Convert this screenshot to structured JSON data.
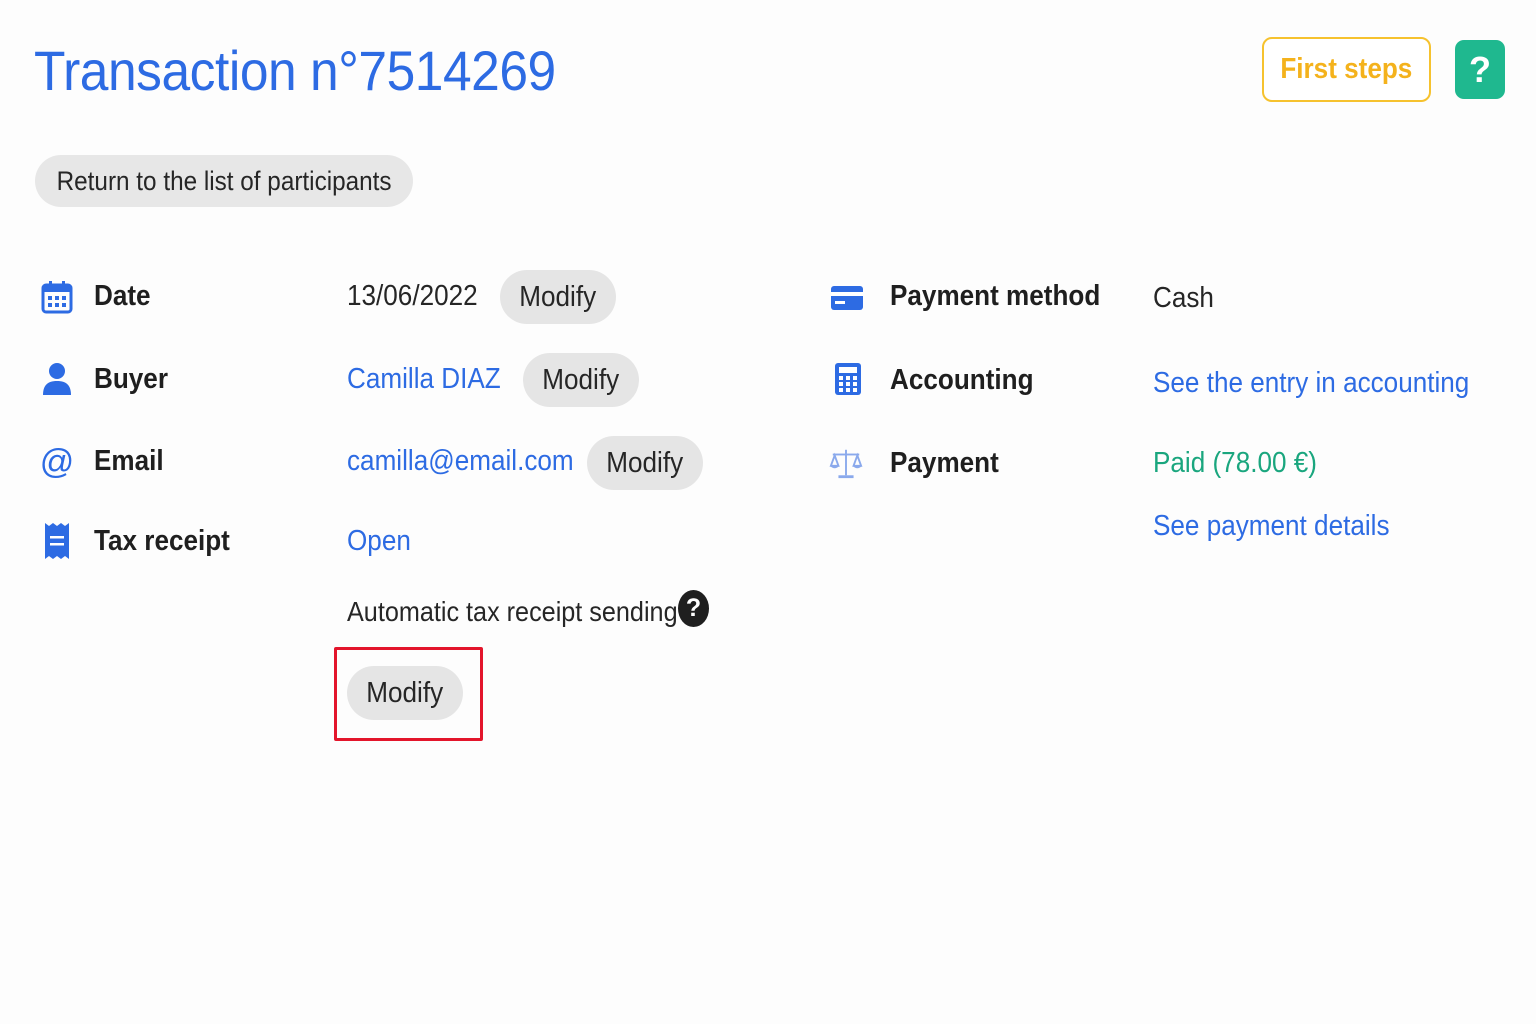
{
  "header": {
    "title": "Transaction n°7514269",
    "first_steps_label": "First steps",
    "help_label": "?"
  },
  "return_button": "Return to the list of participants",
  "left_fields": {
    "date": {
      "label": "Date",
      "value": "13/06/2022",
      "modify": "Modify",
      "icon": "calendar-icon"
    },
    "buyer": {
      "label": "Buyer",
      "value": "Camilla DIAZ",
      "modify": "Modify",
      "icon": "user-icon"
    },
    "email": {
      "label": "Email",
      "value": "camilla@email.com",
      "modify": "Modify",
      "icon": "at-icon"
    },
    "tax_receipt": {
      "label": "Tax receipt",
      "value": "Open",
      "icon": "receipt-icon",
      "auto_sending_text": "Automatic tax receipt sending",
      "help": "?",
      "modify": "Modify"
    }
  },
  "right_fields": {
    "payment_method": {
      "label": "Payment method",
      "value": "Cash",
      "icon": "credit-card-icon"
    },
    "accounting": {
      "label": "Accounting",
      "link": "See the entry in accounting",
      "icon": "calculator-icon"
    },
    "payment": {
      "label": "Payment",
      "status": "Paid (78.00 €)",
      "details_link": "See payment details",
      "icon": "scale-icon"
    }
  },
  "colors": {
    "primary_blue": "#2d6be3",
    "yellow": "#f4b21c",
    "green": "#1fb88f",
    "paid_green": "#1aa67e",
    "highlight_red": "#e3152b"
  }
}
